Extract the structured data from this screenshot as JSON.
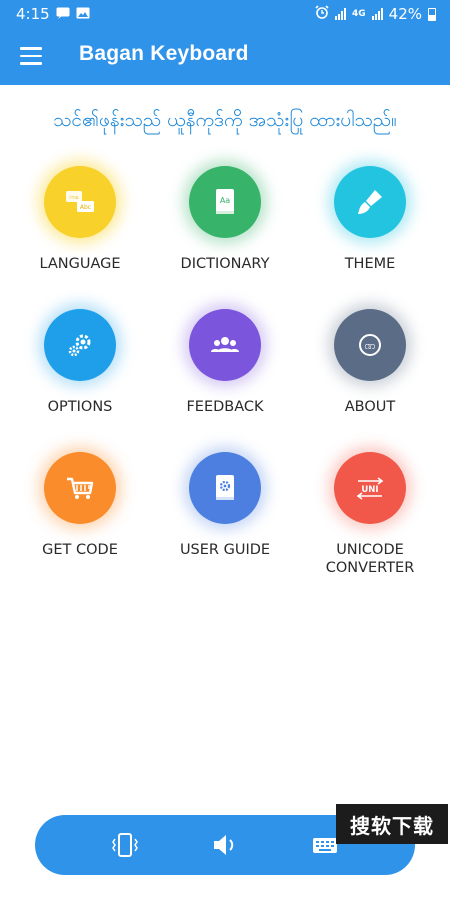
{
  "status_bar": {
    "time": "4:15",
    "network_label": "4G",
    "battery_percent": "42%"
  },
  "app_bar": {
    "title": "Bagan Keyboard"
  },
  "subtitle": "သင်၏ဖုန်းသည် ယူနီကုဒ်ကို အသုံးပြု ထားပါသည်။",
  "tiles": [
    {
      "label": "LANGUAGE",
      "color": "#f8d22a",
      "icon": "language-icon"
    },
    {
      "label": "DICTIONARY",
      "color": "#37b36a",
      "icon": "dictionary-icon"
    },
    {
      "label": "THEME",
      "color": "#22c4e0",
      "icon": "brush-icon"
    },
    {
      "label": "OPTIONS",
      "color": "#1f9fea",
      "icon": "gears-icon"
    },
    {
      "label": "FEEDBACK",
      "color": "#7c55dd",
      "icon": "users-icon"
    },
    {
      "label": "ABOUT",
      "color": "#5a6c86",
      "icon": "about-icon"
    },
    {
      "label": "GET CODE",
      "color": "#fb8c2c",
      "icon": "cart-icon"
    },
    {
      "label": "USER GUIDE",
      "color": "#4d7fe0",
      "icon": "guide-book-icon"
    },
    {
      "label": "UNICODE\nCONVERTER",
      "color": "#f2584a",
      "icon": "converter-icon"
    }
  ],
  "converter_icon_text": "UNI",
  "dictionary_icon_text": "Aa",
  "about_icon_text": "ဏ",
  "language_icon_text": {
    "top": "ကခ",
    "bottom": "Abc"
  },
  "bottom_bar": {
    "buttons": [
      "vibration-icon",
      "sound-icon",
      "keyboard-icon"
    ]
  },
  "watermark": "搜软下载"
}
